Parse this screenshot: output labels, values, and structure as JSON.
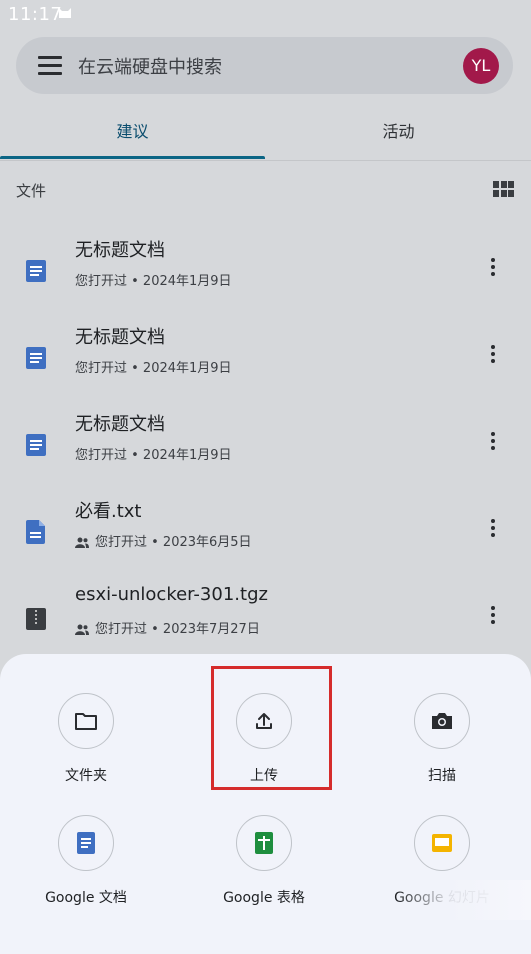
{
  "status_bar": {
    "time": "11:17"
  },
  "search": {
    "placeholder": "在云端硬盘中搜索",
    "avatar_initials": "YL",
    "avatar_color": "#a2194a"
  },
  "tabs": [
    {
      "label": "建议",
      "active": true
    },
    {
      "label": "活动",
      "active": false
    }
  ],
  "section": {
    "label": "文件"
  },
  "files": [
    {
      "name": "无标题文档",
      "meta": "您打开过 • 2024年1月9日",
      "shared": false,
      "icon": "google-docs-icon"
    },
    {
      "name": "无标题文档",
      "meta": "您打开过 • 2024年1月9日",
      "shared": false,
      "icon": "google-docs-icon"
    },
    {
      "name": "无标题文档",
      "meta": "您打开过 • 2024年1月9日",
      "shared": false,
      "icon": "google-docs-icon"
    },
    {
      "name": "必看.txt",
      "meta": "您打开过 • 2023年6月5日",
      "shared": true,
      "icon": "text-file-icon"
    },
    {
      "name": "esxi-unlocker-301.tgz",
      "meta": "您打开过 • 2023年7月27日",
      "shared": true,
      "icon": "archive-file-icon"
    }
  ],
  "sheet": {
    "actions": [
      {
        "label": "文件夹",
        "icon": "folder-icon"
      },
      {
        "label": "上传",
        "icon": "upload-icon"
      },
      {
        "label": "扫描",
        "icon": "camera-icon"
      },
      {
        "label": "Google 文档",
        "icon": "google-docs-icon"
      },
      {
        "label": "Google 表格",
        "icon": "google-sheets-icon"
      },
      {
        "label": "Google 幻灯片",
        "icon": "google-slides-icon"
      }
    ]
  },
  "colors": {
    "accent": "#0b6585",
    "highlight": "#d52b2b",
    "docs_blue": "#3f6fc1",
    "sheets_green": "#1e8e3e",
    "slides_yellow": "#f4b400"
  }
}
